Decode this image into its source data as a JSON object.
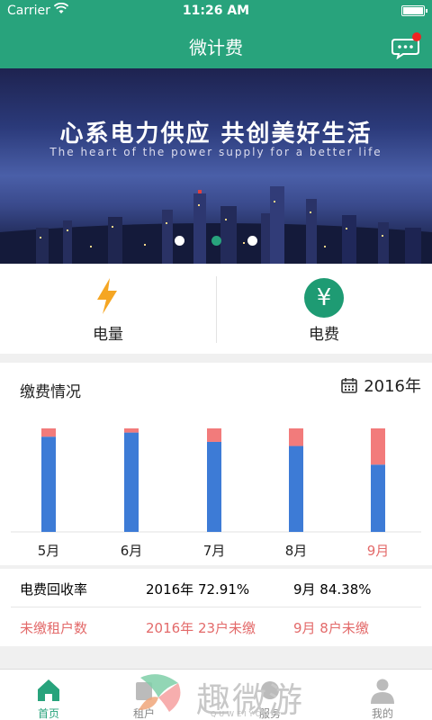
{
  "status": {
    "carrier": "Carrier",
    "time": "11:26 AM"
  },
  "nav": {
    "title": "微计费"
  },
  "banner": {
    "headline": "心系电力供应 共创美好生活",
    "subline": "The heart of the power supply for a better life",
    "slide_count": 3,
    "active_slide": 2
  },
  "features": [
    {
      "label": "电量",
      "icon": "lightning-icon"
    },
    {
      "label": "电费",
      "icon": "yen-icon",
      "symbol": "¥"
    }
  ],
  "payment": {
    "title": "缴费情况",
    "year": "2016年",
    "colors": {
      "paid": "#3d7bd6",
      "unpaid": "#f27b7b",
      "highlight_label": "#e36a6a"
    }
  },
  "chart_data": {
    "type": "bar",
    "stacked": true,
    "categories": [
      "5月",
      "6月",
      "7月",
      "8月",
      "9月"
    ],
    "highlight_category": "9月",
    "series": [
      {
        "values": [
          92,
          96,
          87,
          83,
          65
        ]
      },
      {
        "values": [
          8,
          4,
          13,
          17,
          35
        ]
      }
    ],
    "ylim": [
      0,
      100
    ],
    "grid": false
  },
  "stats": {
    "rate_label": "电费回收率",
    "rate_year": "2016年 72.91%",
    "rate_month": "9月 84.38%",
    "unpaid_label": "未缴租户数",
    "unpaid_year": "2016年 23户未缴",
    "unpaid_month": "9月 8户未缴"
  },
  "tabs": [
    {
      "label": "首页",
      "icon": "home-icon",
      "active": true
    },
    {
      "label": "租户",
      "icon": "tenant-icon",
      "active": false
    },
    {
      "label": "服务",
      "icon": "service-icon",
      "active": false
    },
    {
      "label": "我的",
      "icon": "profile-icon",
      "active": false
    }
  ],
  "watermark": {
    "text": "趣微游",
    "sub": "QUWEIYOU"
  }
}
